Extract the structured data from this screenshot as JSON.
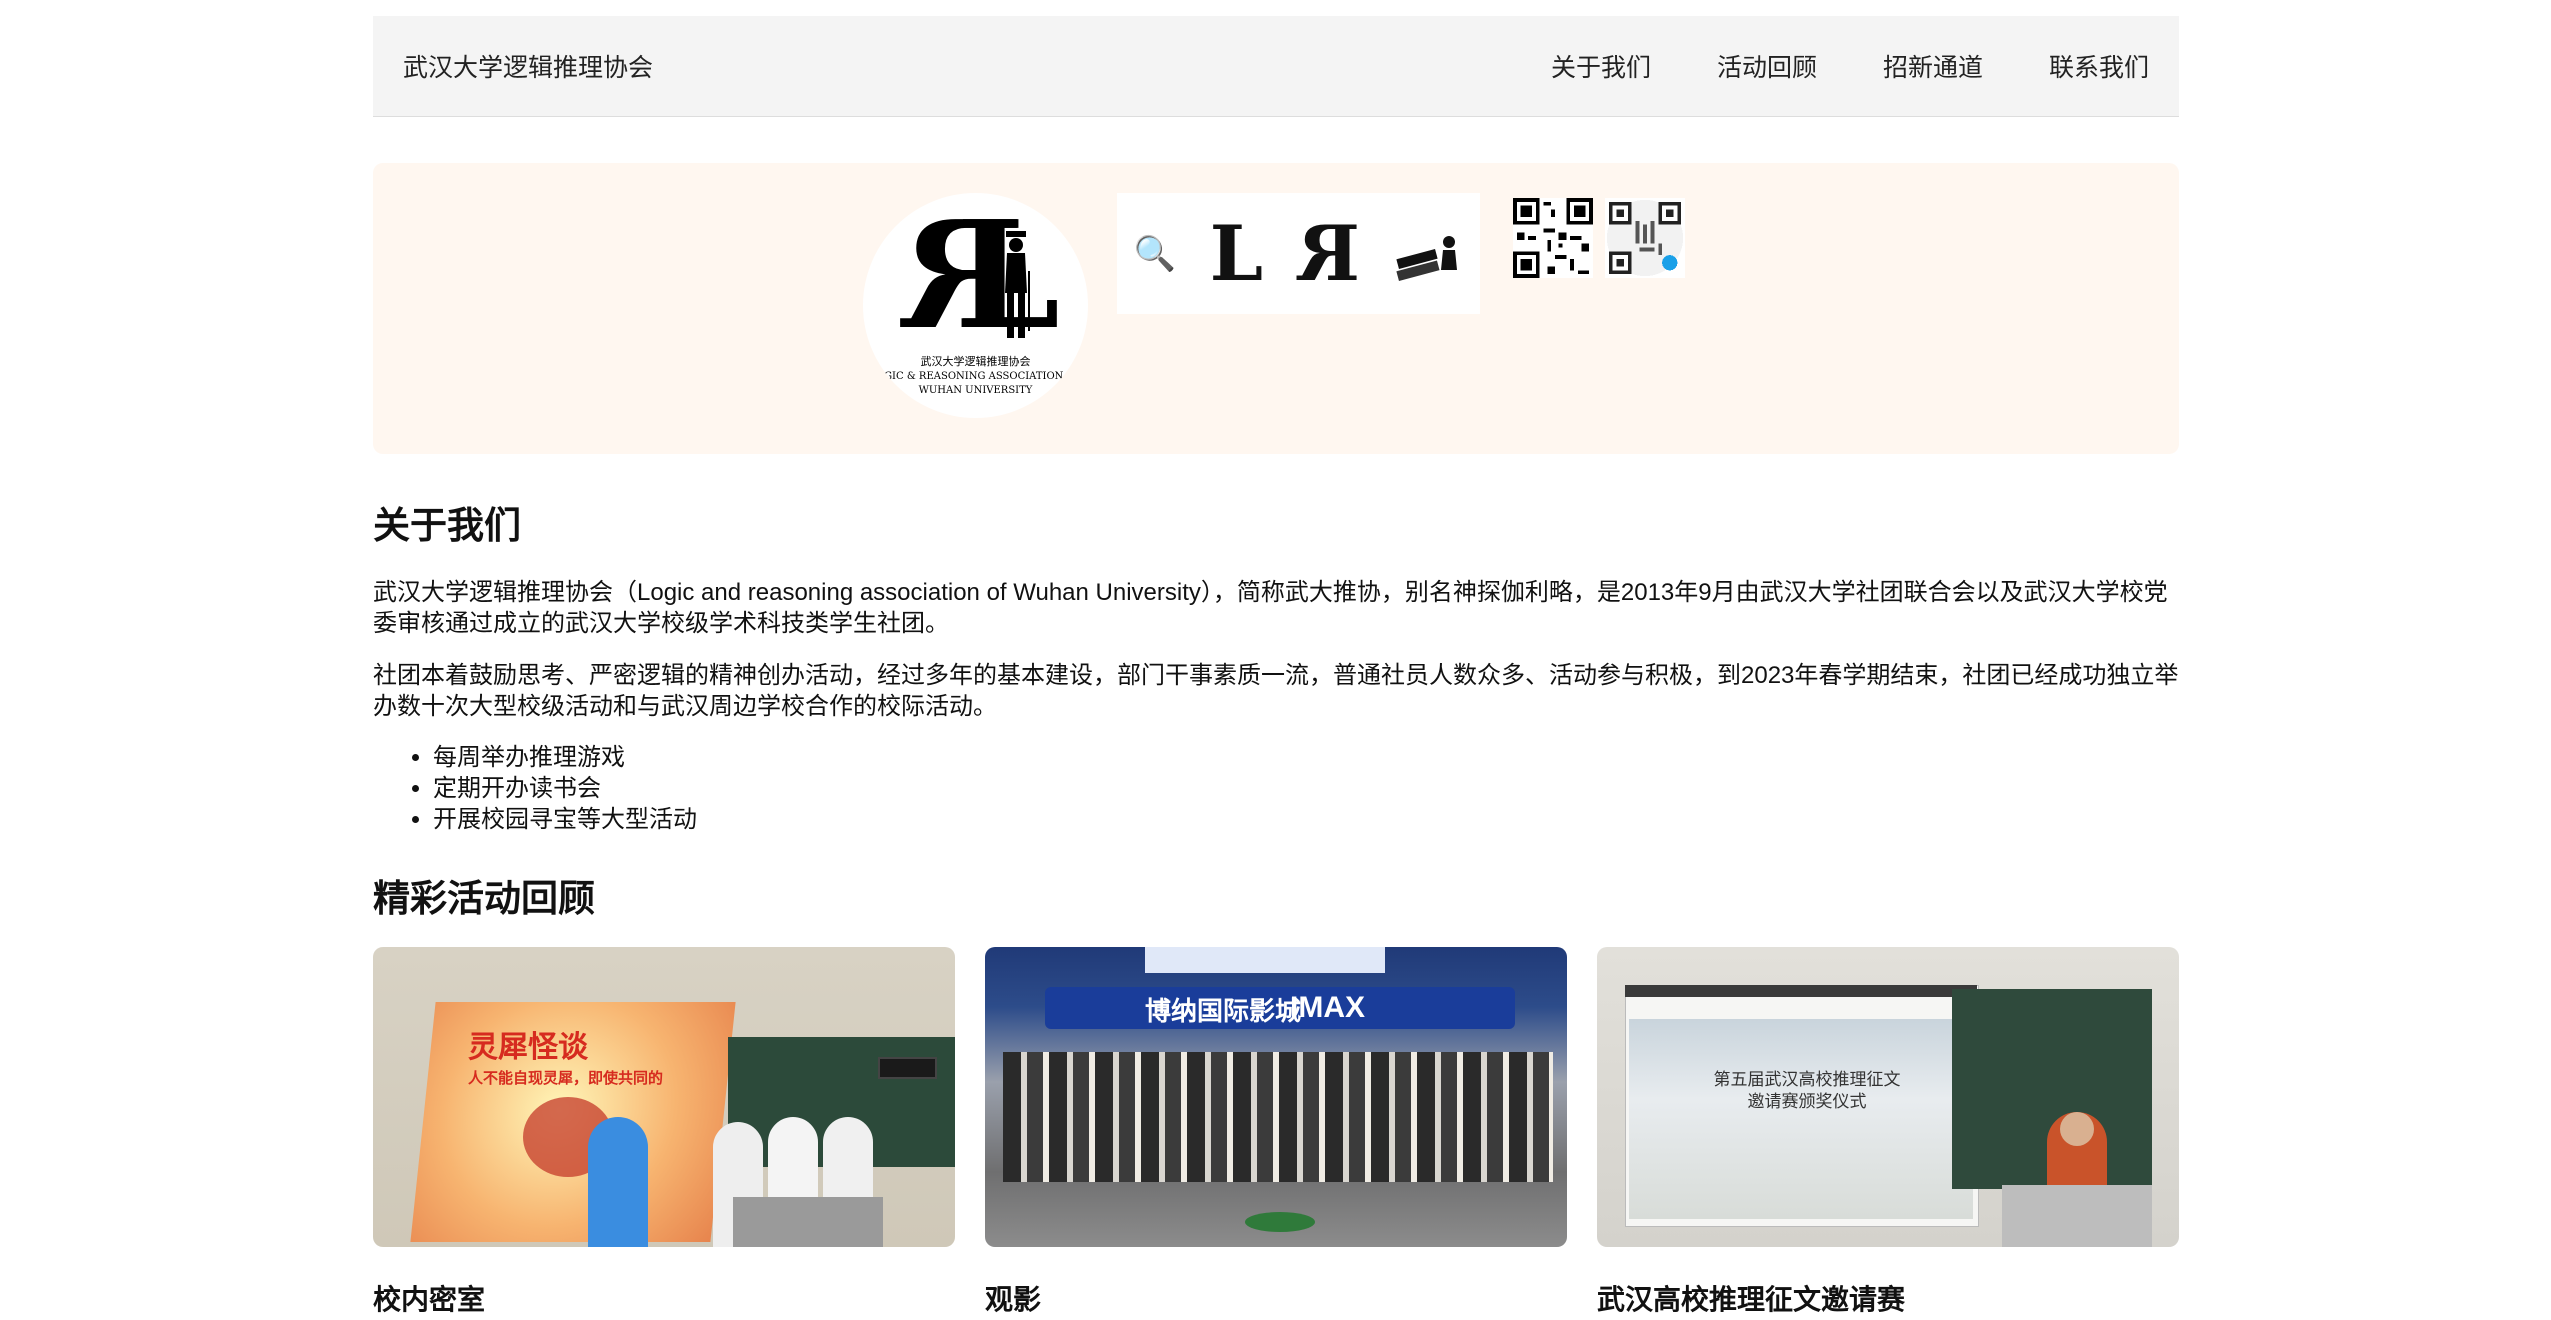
{
  "nav": {
    "brand": "武汉大学逻辑推理协会",
    "links": [
      "关于我们",
      "活动回顾",
      "招新通道",
      "联系我们"
    ]
  },
  "banner": {
    "logo_caption_cn": "武汉大学逻辑推理协会",
    "logo_caption_en_1": "LOGIC & REASONING ASSOCIATION OF",
    "logo_caption_en_2": "WUHAN UNIVERSITY",
    "strip_letters": [
      "L",
      "R"
    ]
  },
  "about": {
    "title": "关于我们",
    "paragraphs": [
      "武汉大学逻辑推理协会（Logic and reasoning association of Wuhan University），简称武大推协，别名神探伽利略，是2013年9月由武汉大学社团联合会以及武汉大学校党委审核通过成立的武汉大学校级学术科技类学生社团。",
      "社团本着鼓励思考、严密逻辑的精神创办活动，经过多年的基本建设，部门干事素质一流，普通社员人数众多、活动参与积极，到2023年春学期结束，社团已经成功独立举办数十次大型校级活动和与武汉周边学校合作的校际活动。"
    ],
    "features": [
      "每周举办推理游戏",
      "定期开办读书会",
      "开展校园寻宝等大型活动"
    ]
  },
  "activities": {
    "title": "精彩活动回顾",
    "cards": [
      {
        "title": "校内密室",
        "photo_text_1": "灵犀怪谈",
        "photo_text_2": "人不能自现灵犀，即使共同的"
      },
      {
        "title": "观影",
        "photo_text_1": "博纳国际影城",
        "photo_text_2": "IMAX"
      },
      {
        "title": "武汉高校推理征文邀请赛",
        "photo_text_1": "第五届武汉高校推理征文",
        "photo_text_2": "邀请赛颁奖仪式"
      }
    ]
  },
  "colors": {
    "nav_bg": "#f4f4f4",
    "banner_bg": "#fff7f0",
    "text": "#111111"
  }
}
